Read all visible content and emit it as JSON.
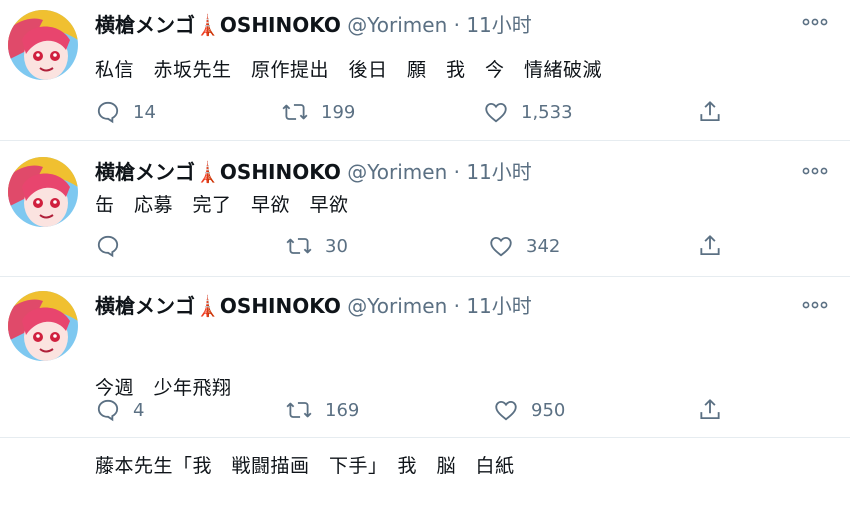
{
  "tweets": [
    {
      "display_name": "横槍メンゴ",
      "name_suffix": "OSHINOKO",
      "tower_glyph": "🗼",
      "handle": "@Yorimen",
      "separator": "·",
      "time": "11小时",
      "lines": [
        "私信　赤坂先生　原作提出　後日　願　我　今　情緒破滅"
      ],
      "reply_count": "14",
      "retweet_count": "199",
      "like_count": "1,533"
    },
    {
      "display_name": "横槍メンゴ",
      "name_suffix": "OSHINOKO",
      "tower_glyph": "🗼",
      "handle": "@Yorimen",
      "separator": "·",
      "time": "11小时",
      "lines": [
        "缶　応募　完了　早欲　早欲"
      ],
      "reply_count": "",
      "retweet_count": "30",
      "like_count": "342"
    },
    {
      "display_name": "横槍メンゴ",
      "name_suffix": "OSHINOKO",
      "tower_glyph": "🗼",
      "handle": "@Yorimen",
      "separator": "·",
      "time": "11小时",
      "lines": [
        "今週　少年飛翔",
        "藤本先生「我　戦闘描画　下手」　我　脳　白紙"
      ],
      "reply_count": "4",
      "retweet_count": "169",
      "like_count": "950"
    }
  ],
  "icons": {
    "more": "more-dots-icon",
    "reply": "reply-bubble-icon",
    "retweet": "retweet-icon",
    "like": "heart-icon",
    "share": "share-upload-icon"
  },
  "colors": {
    "text": "#0f1419",
    "muted": "#5b7083",
    "divider": "#e6ecf0",
    "tower": "#e0245e"
  }
}
